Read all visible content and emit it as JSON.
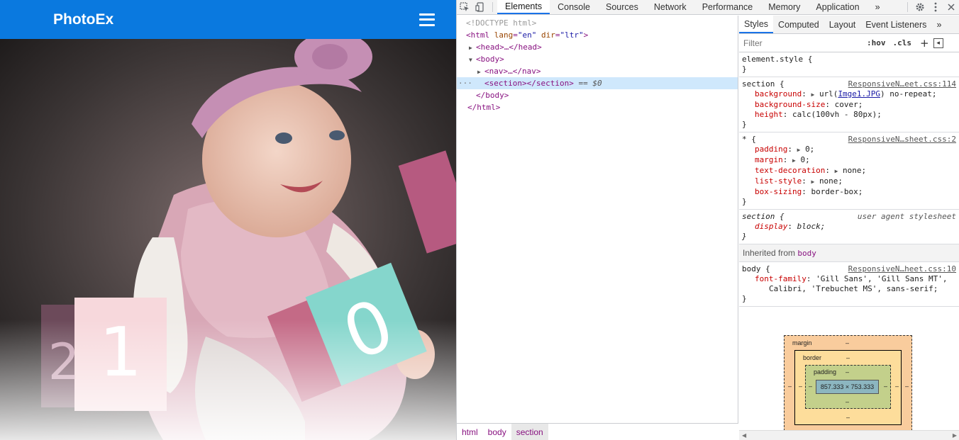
{
  "preview": {
    "brand": "PhotoEx",
    "photo_alt": "Smiling baby with pink headband sitting with number blocks"
  },
  "toolbar": {
    "tabs": [
      "Elements",
      "Console",
      "Sources",
      "Network",
      "Performance",
      "Memory",
      "Application"
    ],
    "active_tab": "Elements",
    "more": "»"
  },
  "dom": {
    "doctype": "<!DOCTYPE html>",
    "html_open_tag": "<html",
    "lang_attr": "lang",
    "lang_val": "\"en\"",
    "dir_attr": "dir",
    "dir_val": "\"ltr\"",
    "head": "<head>…</head>",
    "body_open": "<body>",
    "nav": "<nav>…</nav>",
    "section": "<section></section>",
    "section_eq": "== $0",
    "body_close": "</body>",
    "html_close": "</html>",
    "dots": "···"
  },
  "breadcrumbs": [
    "html",
    "body",
    "section"
  ],
  "styles_tabs": [
    "Styles",
    "Computed",
    "Layout",
    "Event Listeners"
  ],
  "styles_more": "»",
  "filter": {
    "placeholder": "Filter",
    "hov": ":hov",
    "cls": ".cls",
    "plus": "+"
  },
  "rules": {
    "element_style": {
      "selector": "element.style {",
      "close": "}"
    },
    "section": {
      "selector": "section {",
      "origin": "ResponsiveN…eet.css:114",
      "decls": [
        {
          "name": "background",
          "value_pre": "url(",
          "value_link": "Imge1.JPG",
          "value_post": ") no-repeat;"
        },
        {
          "name": "background-size",
          "value": "cover;"
        },
        {
          "name": "height",
          "value": "calc(100vh - 80px);"
        }
      ],
      "close": "}"
    },
    "star": {
      "selector": "* {",
      "origin": "ResponsiveN…sheet.css:2",
      "decls": [
        {
          "name": "padding",
          "value": "0;"
        },
        {
          "name": "margin",
          "value": "0;"
        },
        {
          "name": "text-decoration",
          "value": "none;"
        },
        {
          "name": "list-style",
          "value": "none;"
        },
        {
          "name": "box-sizing",
          "value": "border-box;"
        }
      ],
      "close": "}"
    },
    "section_ua": {
      "selector": "section {",
      "origin": "user agent stylesheet",
      "decls": [
        {
          "name": "display",
          "value": "block;"
        }
      ],
      "close": "}"
    },
    "inherited_label": "Inherited from",
    "inherited_from": "body",
    "body": {
      "selector": "body {",
      "origin": "ResponsiveN…heet.css:10",
      "font_name": "font-family",
      "font_value_1": "'Gill Sans', 'Gill Sans MT',",
      "font_value_2": "Calibri, 'Trebuchet MS', sans-serif;",
      "close": "}"
    }
  },
  "box_model": {
    "margin_label": "margin",
    "border_label": "border",
    "padding_label": "padding",
    "dash": "–",
    "content_size": "857.333 × 753.333"
  }
}
